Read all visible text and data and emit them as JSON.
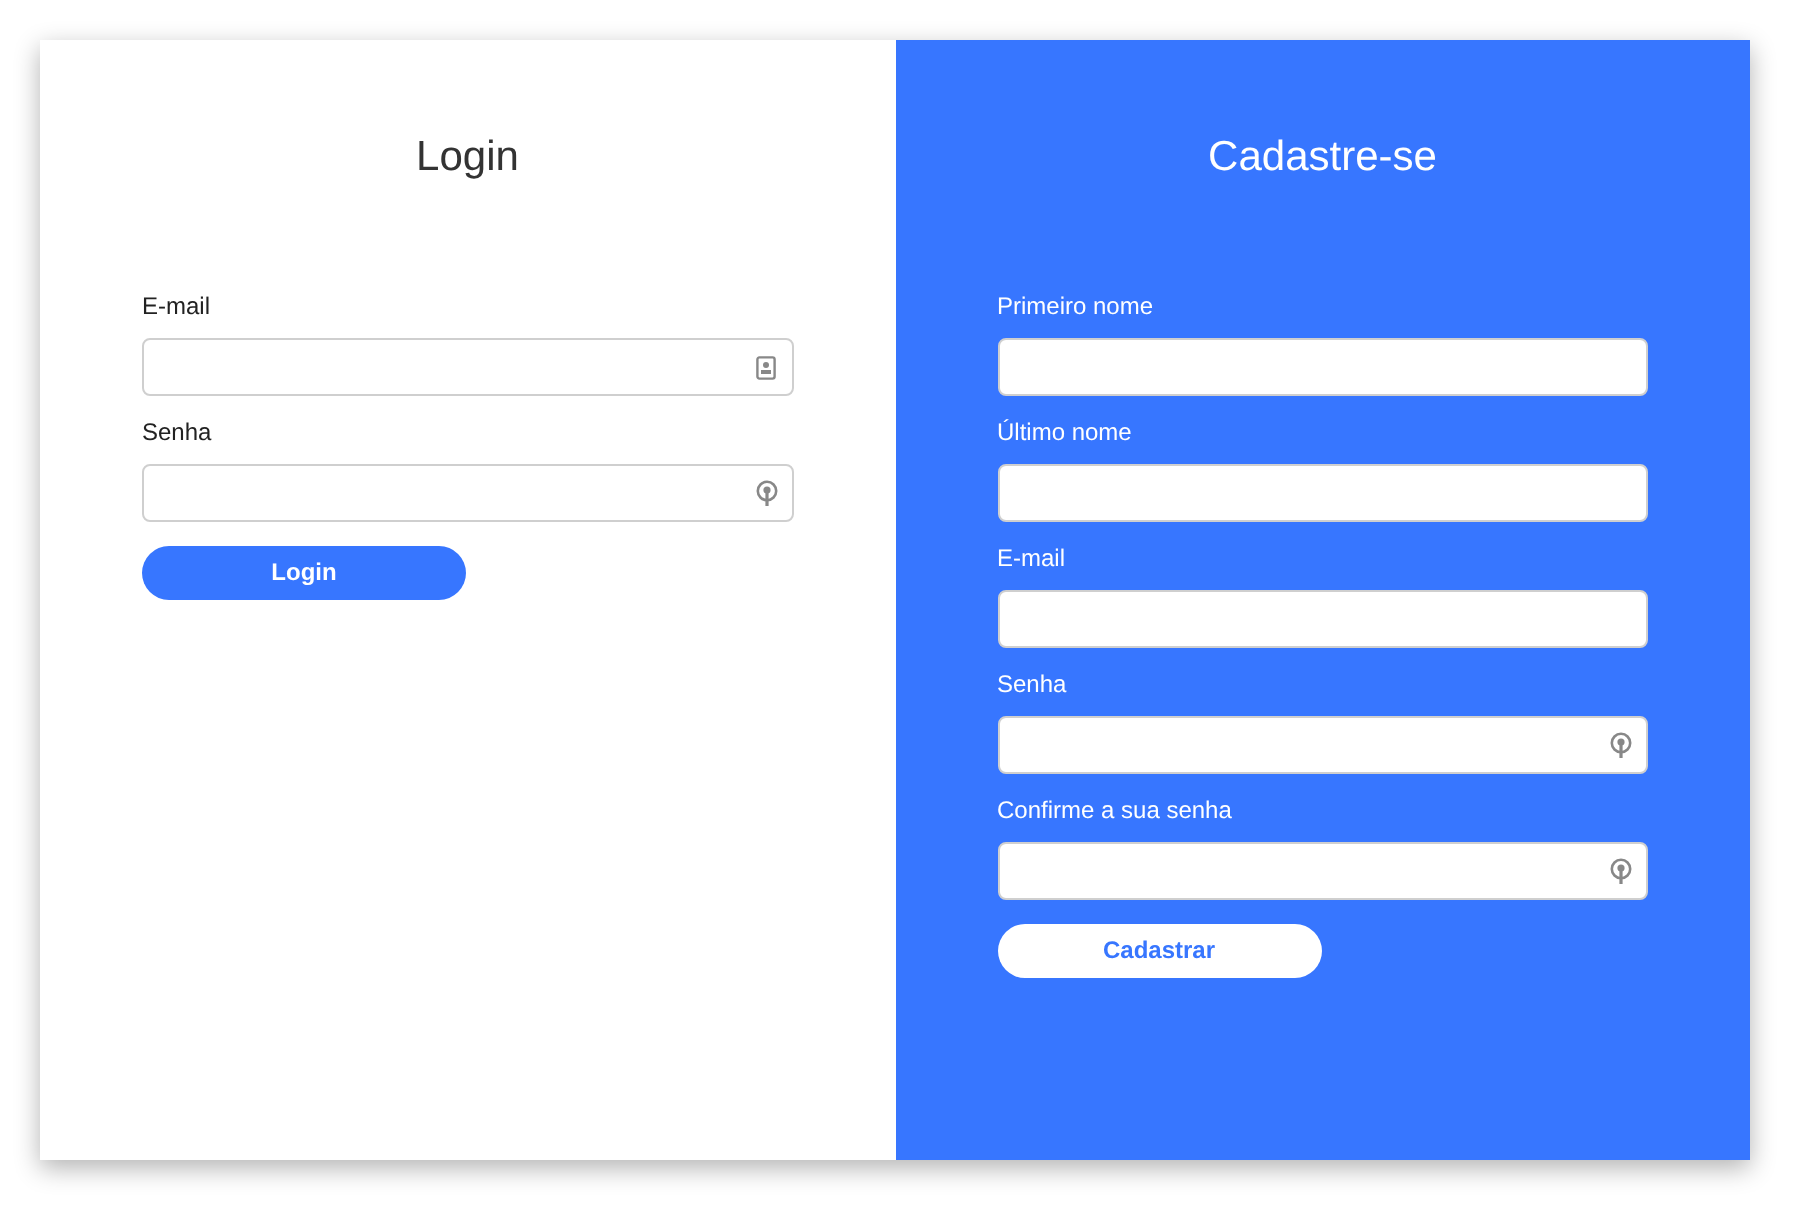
{
  "login": {
    "title": "Login",
    "fields": [
      {
        "label": "E-mail",
        "kind": "email"
      },
      {
        "label": "Senha",
        "kind": "password"
      }
    ],
    "button": "Login"
  },
  "register": {
    "title": "Cadastre-se",
    "fields": [
      {
        "label": "Primeiro nome",
        "kind": "text"
      },
      {
        "label": "Último nome",
        "kind": "text"
      },
      {
        "label": "E-mail",
        "kind": "text"
      },
      {
        "label": "Senha",
        "kind": "password"
      },
      {
        "label": "Confirme a sua senha",
        "kind": "password"
      }
    ],
    "button": "Cadastrar"
  }
}
